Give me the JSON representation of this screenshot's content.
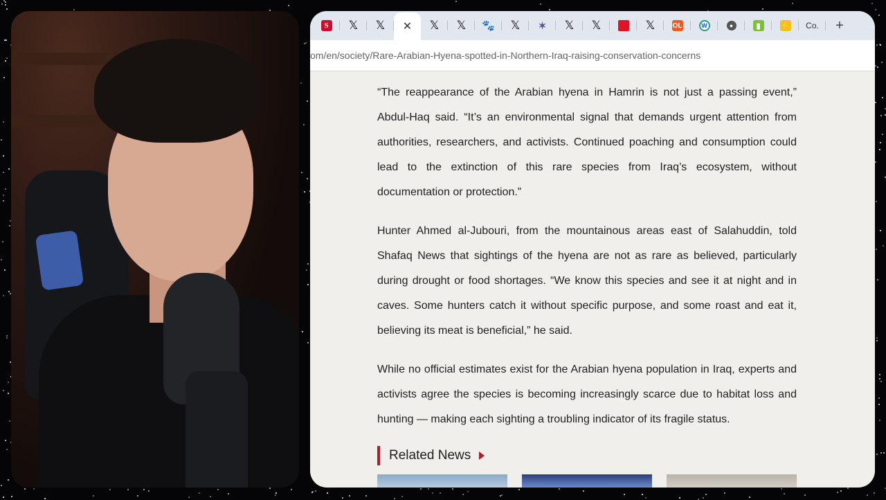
{
  "browser": {
    "tabs": [
      {
        "icon": "shafaq-s-icon",
        "glyph": "S"
      },
      {
        "icon": "x-icon",
        "glyph": "𝕏"
      },
      {
        "icon": "x-icon",
        "glyph": "𝕏"
      },
      {
        "icon": "close-icon",
        "glyph": "✕",
        "active": true
      },
      {
        "icon": "x-icon",
        "glyph": "𝕏"
      },
      {
        "icon": "x-icon",
        "glyph": "𝕏"
      },
      {
        "icon": "paw-icon",
        "glyph": "🐾"
      },
      {
        "icon": "x-icon",
        "glyph": "𝕏"
      },
      {
        "icon": "bird-icon",
        "glyph": "✶"
      },
      {
        "icon": "x-icon",
        "glyph": "𝕏"
      },
      {
        "icon": "x-icon",
        "glyph": "𝕏"
      },
      {
        "icon": "red-square-icon",
        "glyph": ""
      },
      {
        "icon": "x-icon",
        "glyph": "𝕏"
      },
      {
        "icon": "ol-icon",
        "glyph": "OL"
      },
      {
        "icon": "wikimedia-icon",
        "glyph": "W"
      },
      {
        "icon": "globe-icon",
        "glyph": "●"
      },
      {
        "icon": "green-app-icon",
        "glyph": "▮"
      },
      {
        "icon": "yellow-app-icon",
        "glyph": "⚡"
      },
      {
        "icon": "co-icon",
        "glyph": "Co."
      }
    ],
    "new_tab": "+",
    "url": "om/en/society/Rare-Arabian-Hyena-spotted-in-Northern-Iraq-raising-conservation-concerns"
  },
  "article": {
    "paragraphs": [
      "“The reappearance of the Arabian hyena in Hamrin is not just a passing event,” Abdul-Haq said. “It’s an environmental signal that demands urgent attention from authorities, researchers, and activists. Continued poaching and consumption could lead to the extinction of this rare species from Iraq’s ecosystem, without documentation or protection.”",
      "Hunter Ahmed al-Jubouri, from the mountainous areas east of Salahuddin, told Shafaq News that sightings of the hyena are not as rare as believed, particularly during drought or food shortages. “We know this species and see it at night and in caves. Some hunters catch it without specific purpose, and some roast and eat it, believing its meat is beneficial,” he said.",
      "While no official estimates exist for the Arabian hyena population in Iraq, experts and activists agree the species is becoming increasingly scarce due to habitat loss and hunting — making each sighting a troubling indicator of its fragile status."
    ],
    "related_title": "Related News"
  },
  "colors": {
    "accent": "#b01c2a",
    "page_bg": "#f1efec",
    "tabbar_bg": "#e2e6ee"
  }
}
